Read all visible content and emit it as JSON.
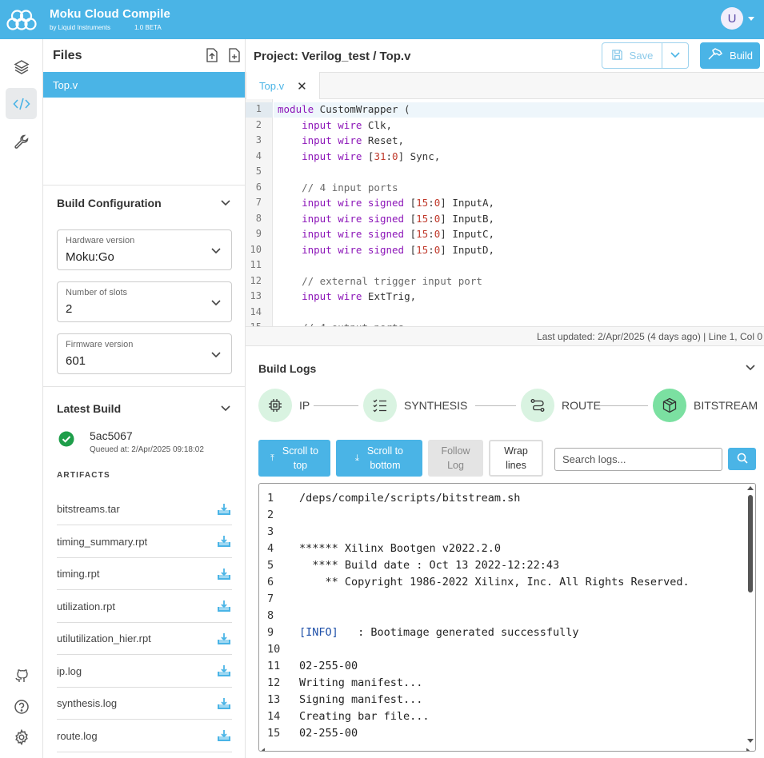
{
  "app": {
    "title": "Moku Cloud Compile",
    "subtitle": "by Liquid Instruments",
    "version": "1.0 BETA",
    "user_initial": "U"
  },
  "colors": {
    "accent": "#4ab4e6",
    "success": "#1e9e4a",
    "stage_bg": "#d9f3e1",
    "stage_done": "#7be0a1"
  },
  "files_panel": {
    "title": "Files",
    "files": [
      "Top.v"
    ]
  },
  "build_config": {
    "title": "Build Configuration",
    "hardware": {
      "label": "Hardware version",
      "value": "Moku:Go"
    },
    "slots": {
      "label": "Number of slots",
      "value": "2"
    },
    "firmware": {
      "label": "Firmware version",
      "value": "601"
    }
  },
  "latest_build": {
    "title": "Latest Build",
    "id": "5ac5067",
    "queued": "Queued at: 2/Apr/2025 09:18:02",
    "artifacts_title": "ARTIFACTS",
    "artifacts": [
      "bitstreams.tar",
      "timing_summary.rpt",
      "timing.rpt",
      "utilization.rpt",
      "utilutilization_hier.rpt",
      "ip.log",
      "synthesis.log",
      "route.log"
    ]
  },
  "project": {
    "title": "Project:  Verilog_test / Top.v",
    "save_label": "Save",
    "build_label": "Build"
  },
  "editor": {
    "tab": "Top.v",
    "status": "Last updated: 2/Apr/2025 (4 days ago) | Line 1, Col 0"
  },
  "build_logs": {
    "title": "Build Logs",
    "stages": [
      "IP",
      "SYNTHESIS",
      "ROUTE",
      "BITSTREAM"
    ],
    "buttons": {
      "scroll_top": [
        "Scroll to",
        "top"
      ],
      "scroll_bottom": [
        "Scroll to",
        "bottom"
      ],
      "follow": [
        "Follow",
        "Log"
      ],
      "wrap": [
        "Wrap",
        "lines"
      ]
    },
    "search_placeholder": "Search logs...",
    "lines": [
      "/deps/compile/scripts/bitstream.sh",
      "",
      "",
      "****** Xilinx Bootgen v2022.2.0",
      "  **** Build date : Oct 13 2022-12:22:43",
      "    ** Copyright 1986-2022 Xilinx, Inc. All Rights Reserved.",
      "",
      "",
      "[INFO]   : Bootimage generated successfully",
      "",
      "02-255-00",
      "Writing manifest...",
      "Signing manifest...",
      "Creating bar file...",
      "02-255-00"
    ]
  }
}
